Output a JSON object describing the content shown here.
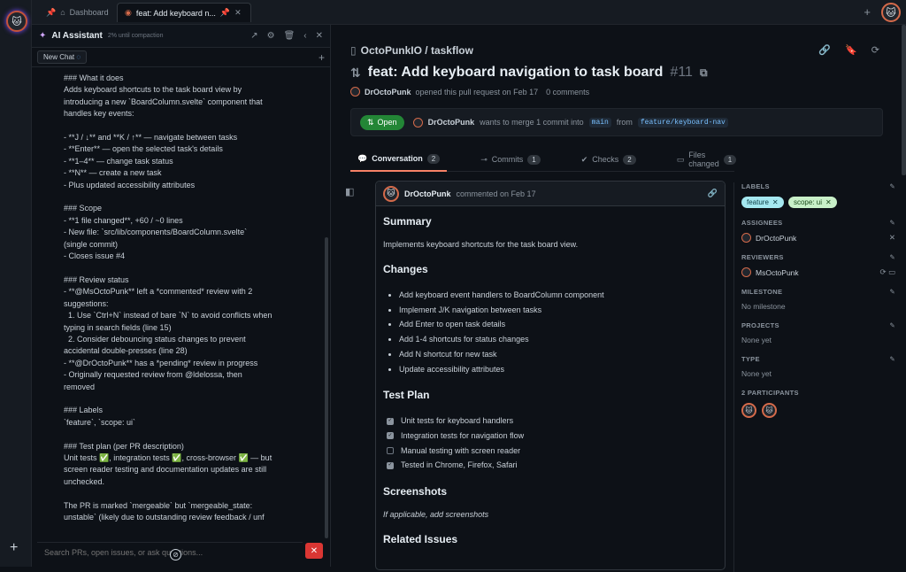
{
  "tabs": [
    {
      "label": "Dashboard",
      "pinned": true
    },
    {
      "label": "feat: Add keyboard n...",
      "pinned": true
    }
  ],
  "ai": {
    "title": "AI Assistant",
    "subtitle": "2% until compaction",
    "chat_tab": "New Chat",
    "message_lines": [
      "### What it does",
      "Adds keyboard shortcuts to the task board view by",
      "introducing a new `BoardColumn.svelte` component that",
      "handles key events:",
      "",
      "- **J / ↓** and **K / ↑** — navigate between tasks",
      "- **Enter** — open the selected task's details",
      "- **1–4** — change task status",
      "- **N** — create a new task",
      "- Plus updated accessibility attributes",
      "",
      "### Scope",
      "- **1 file changed**, +60 / ~0 lines",
      "- New file: `src/lib/components/BoardColumn.svelte`",
      "(single commit)",
      "- Closes issue #4",
      "",
      "### Review status",
      "- **@MsOctoPunk** left a *commented* review with 2",
      "suggestions:",
      "  1. Use `Ctrl+N` instead of bare `N` to avoid conflicts when",
      "typing in search fields (line 15)",
      "  2. Consider debouncing status changes to prevent",
      "accidental double-presses (line 28)",
      "- **@DrOctoPunk** has a *pending* review in progress",
      "- Originally requested review from @ldelossa, then",
      "removed",
      "",
      "### Labels",
      "`feature`, `scope: ui`",
      "",
      "### Test plan (per PR description)",
      "Unit tests ✅, integration tests ✅, cross-browser ✅ — but",
      "screen reader testing and documentation updates are still",
      "unchecked.",
      "",
      "The PR is marked `mergeable` but `mergeable_state:",
      "unstable` (likely due to outstanding review feedback / unf"
    ],
    "input_placeholder": "Search PRs, open issues, or ask questions..."
  },
  "repo": "OctoPunkIO / taskflow",
  "pr": {
    "title": "feat: Add keyboard navigation to task board",
    "number": "#11",
    "author": "DrOctoPunk",
    "meta_text": "opened this pull request on Feb 17",
    "comments": "0 comments",
    "state": "Open",
    "merge_author": "DrOctoPunk",
    "merge_text": "wants to merge 1 commit into",
    "base": "main",
    "from": "from",
    "head": "feature/keyboard-nav"
  },
  "pr_tabs": [
    {
      "label": "Conversation",
      "count": "2",
      "icon": "comment-icon"
    },
    {
      "label": "Commits",
      "count": "1",
      "icon": "commit-icon"
    },
    {
      "label": "Checks",
      "count": "2",
      "icon": "check-circle-icon"
    },
    {
      "label": "Files changed",
      "count": "1",
      "icon": "file-icon"
    }
  ],
  "comment": {
    "author": "DrOctoPunk",
    "when": "commented on Feb 17",
    "summary_h": "Summary",
    "summary": "Implements keyboard shortcuts for the task board view.",
    "changes_h": "Changes",
    "changes": [
      "Add keyboard event handlers to BoardColumn component",
      "Implement J/K navigation between tasks",
      "Add Enter to open task details",
      "Add 1-4 shortcuts for status changes",
      "Add N shortcut for new task",
      "Update accessibility attributes"
    ],
    "testplan_h": "Test Plan",
    "tests": [
      {
        "label": "Unit tests for keyboard handlers",
        "checked": true
      },
      {
        "label": "Integration tests for navigation flow",
        "checked": true
      },
      {
        "label": "Manual testing with screen reader",
        "checked": false
      },
      {
        "label": "Tested in Chrome, Firefox, Safari",
        "checked": true
      }
    ],
    "screenshots_h": "Screenshots",
    "screenshots": "If applicable, add screenshots",
    "related_h": "Related Issues"
  },
  "sidebar": {
    "labels_h": "LABELS",
    "labels": [
      {
        "name": "feature",
        "bg": "#a5e8f0",
        "fg": "#0b3d45"
      },
      {
        "name": "scope: ui",
        "bg": "#c8f0c8",
        "fg": "#1b4a1b"
      }
    ],
    "assignees_h": "ASSIGNEES",
    "assignee": "DrOctoPunk",
    "reviewers_h": "REVIEWERS",
    "reviewer": "MsOctoPunk",
    "milestone_h": "MILESTONE",
    "milestone": "No milestone",
    "projects_h": "PROJECTS",
    "projects": "None yet",
    "type_h": "TYPE",
    "type": "None yet",
    "participants_h": "2 PARTICIPANTS"
  }
}
